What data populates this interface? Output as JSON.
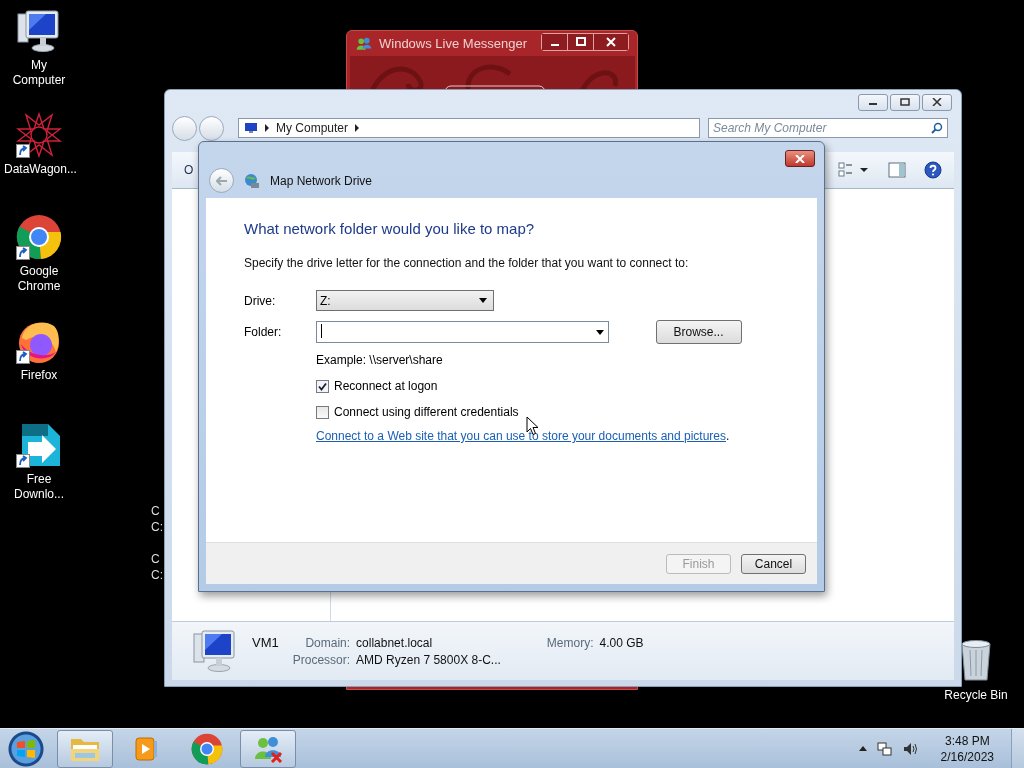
{
  "desktop": {
    "icons": [
      {
        "label": "My Computer",
        "kind": "computer",
        "shortcut": false
      },
      {
        "label": "DataWagon...",
        "kind": "star",
        "shortcut": true
      },
      {
        "label": "Google Chrome",
        "kind": "chrome",
        "shortcut": true
      },
      {
        "label": "Firefox",
        "kind": "firefox",
        "shortcut": true
      },
      {
        "label": "Free Downlo...",
        "kind": "download",
        "shortcut": true
      }
    ],
    "clipped_labels": [
      "C",
      "C:",
      "C",
      "C:"
    ],
    "recycle_bin": {
      "label": "Recycle Bin"
    }
  },
  "messenger": {
    "title": "Windows Live Messenger"
  },
  "explorer": {
    "address": "My Computer",
    "search": {
      "placeholder": "Search My Computer"
    },
    "toolbar_first": "O",
    "details": {
      "name": "VM1",
      "fields": [
        {
          "label": "Domain:",
          "value": "collabnet.local"
        },
        {
          "label": "Memory:",
          "value": "4.00 GB"
        },
        {
          "label": "Processor:",
          "value": "AMD Ryzen 7 5800X 8-C..."
        }
      ]
    }
  },
  "dialog": {
    "title": "Map Network Drive",
    "heading": "What network folder would you like to map?",
    "instruction": "Specify the drive letter for the connection and the folder that you want to connect to:",
    "drive": {
      "label": "Drive:",
      "value": "Z:"
    },
    "folder": {
      "label": "Folder:",
      "focused": true
    },
    "browse": "Browse...",
    "example": "Example: \\\\server\\share",
    "options": [
      {
        "label": "Reconnect at logon",
        "checked": true
      },
      {
        "label": "Connect using different credentials",
        "checked": false
      }
    ],
    "link": {
      "text": "Connect to a Web site that you can use to store your documents and pictures",
      "after": "."
    },
    "buttons": [
      {
        "label": "Finish",
        "disabled": true
      },
      {
        "label": "Cancel",
        "disabled": false
      }
    ]
  },
  "taskbar": {
    "buttons": [
      {
        "kind": "explorer",
        "open": true
      },
      {
        "kind": "media",
        "open": false
      },
      {
        "kind": "chrome",
        "open": false
      },
      {
        "kind": "messenger",
        "open": true
      }
    ],
    "time": "3:48 PM",
    "date": "2/16/2023"
  }
}
